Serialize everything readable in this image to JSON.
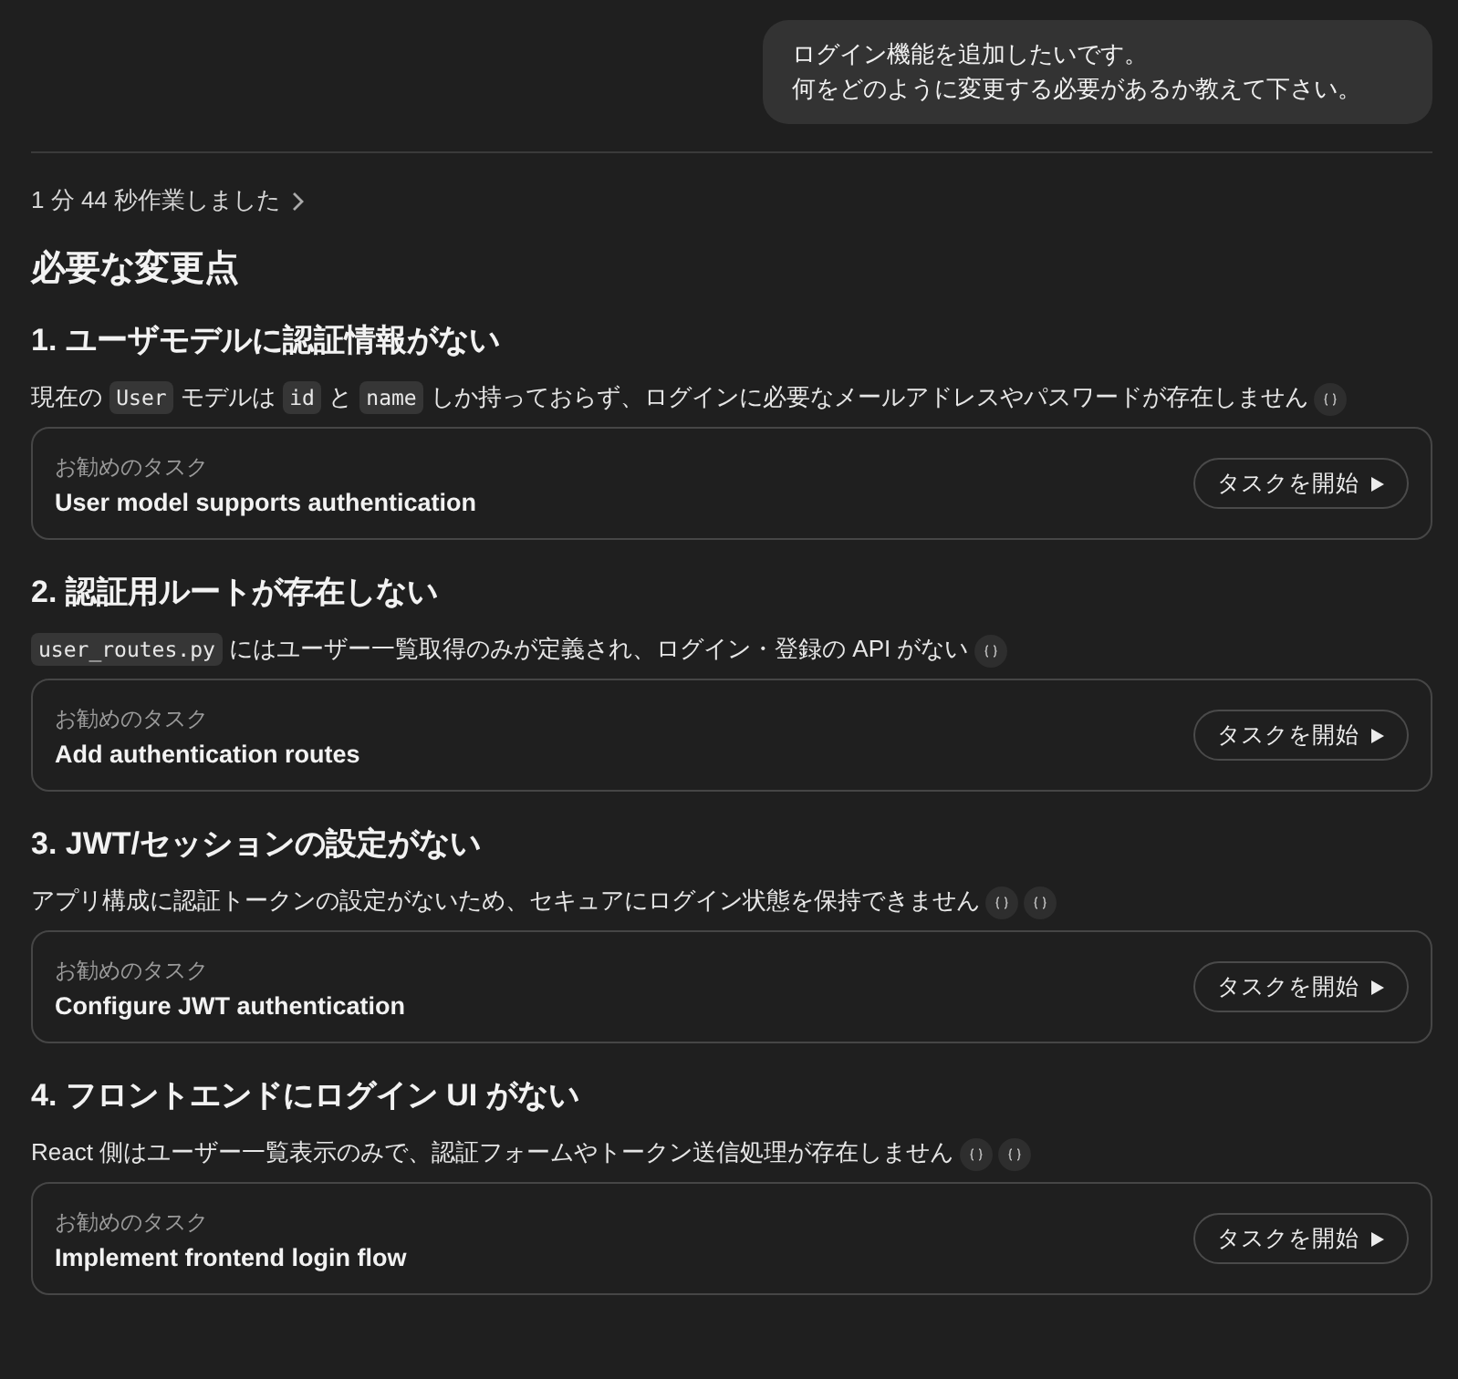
{
  "user_message": {
    "lines": [
      "ログイン機能を追加したいです。",
      "何をどのように変更する必要があるか教えて下さい。"
    ]
  },
  "work_summary": {
    "text": "1 分 44 秒作業しました",
    "expanded": false
  },
  "title": "必要な変更点",
  "sections": [
    {
      "heading": "1. ユーザモデルに認証情報がない",
      "description": [
        {
          "kind": "text",
          "text": "現在の "
        },
        {
          "kind": "code",
          "text": "User"
        },
        {
          "kind": "text",
          "text": " モデルは "
        },
        {
          "kind": "code",
          "text": "id"
        },
        {
          "kind": "text",
          "text": " と "
        },
        {
          "kind": "code",
          "text": "name"
        },
        {
          "kind": "text",
          "text": " しか持っておらず、ログインに必要なメールアドレスやパスワードが存在しません"
        }
      ],
      "citations": [
        {
          "kind": "source"
        }
      ],
      "task": {
        "label": "お勧めのタスク",
        "title": "User model supports authentication",
        "button": "タスクを開始"
      }
    },
    {
      "heading": "2. 認証用ルートが存在しない",
      "description": [
        {
          "kind": "code",
          "text": "user_routes.py"
        },
        {
          "kind": "text",
          "text": " にはユーザー一覧取得のみが定義され、ログイン・登録の API がない"
        }
      ],
      "citations": [
        {
          "kind": "source"
        }
      ],
      "task": {
        "label": "お勧めのタスク",
        "title": "Add authentication routes",
        "button": "タスクを開始"
      }
    },
    {
      "heading": "3. JWT/セッションの設定がない",
      "description": [
        {
          "kind": "text",
          "text": "アプリ構成に認証トークンの設定がないため、セキュアにログイン状態を保持できません"
        }
      ],
      "citations": [
        {
          "kind": "source"
        },
        {
          "kind": "source"
        }
      ],
      "task": {
        "label": "お勧めのタスク",
        "title": "Configure JWT authentication",
        "button": "タスクを開始"
      }
    },
    {
      "heading": "4. フロントエンドにログイン UI がない",
      "description": [
        {
          "kind": "text",
          "text": "React 側はユーザー一覧表示のみで、認証フォームやトークン送信処理が存在しません"
        }
      ],
      "citations": [
        {
          "kind": "source"
        },
        {
          "kind": "source"
        }
      ],
      "task": {
        "label": "お勧めのタスク",
        "title": "Implement frontend login flow",
        "button": "タスクを開始"
      }
    }
  ]
}
